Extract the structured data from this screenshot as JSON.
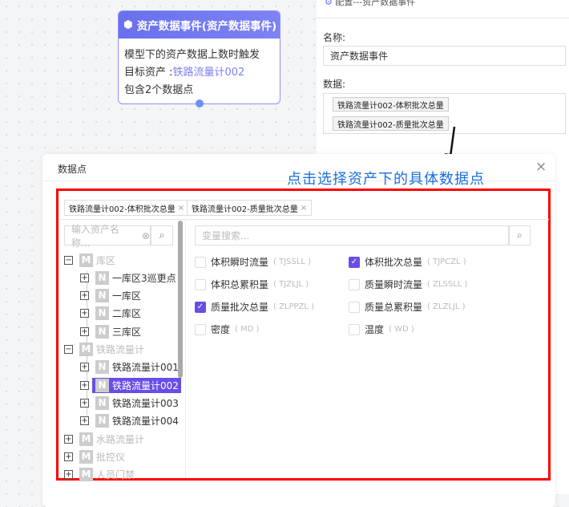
{
  "node": {
    "title": "资产数据事件(资产数据事件)",
    "desc": "模型下的资产数据上数时触发",
    "target_label": "目标资产 :",
    "target_value": "铁路流量计002",
    "count": "包含2个数据点"
  },
  "panel": {
    "header": "配置---资产数据事件",
    "name_label": "名称:",
    "name_value": "资产数据事件",
    "data_label": "数据:",
    "data_tags": [
      "铁路流量计002-体积批次总量",
      "铁路流量计002-质量批次总量"
    ]
  },
  "annotation": "点击选择资产下的具体数据点",
  "dialog": {
    "title": "数据点",
    "close": "×",
    "selected_tags": [
      "铁路流量计002-体积批次总量",
      "铁路流量计002-质量批次总量"
    ],
    "asset_search_placeholder": "输入资产名称...",
    "var_search_placeholder": "变量搜索...",
    "tree": [
      {
        "level": 0,
        "toggle": "−",
        "badge": "M",
        "label": "库区",
        "muted": true
      },
      {
        "level": 1,
        "toggle": "+",
        "badge": "N",
        "label": "一库区3巡更点"
      },
      {
        "level": 1,
        "toggle": "+",
        "badge": "N",
        "label": "一库区"
      },
      {
        "level": 1,
        "toggle": "+",
        "badge": "N",
        "label": "二库区"
      },
      {
        "level": 1,
        "toggle": "+",
        "badge": "N",
        "label": "三库区"
      },
      {
        "level": 0,
        "toggle": "−",
        "badge": "M",
        "label": "铁路流量计",
        "muted": true
      },
      {
        "level": 1,
        "toggle": "+",
        "badge": "N",
        "label": "铁路流量计001"
      },
      {
        "level": 1,
        "toggle": "+",
        "badge": "N",
        "label": "铁路流量计002",
        "selected": true
      },
      {
        "level": 1,
        "toggle": "+",
        "badge": "N",
        "label": "铁路流量计003"
      },
      {
        "level": 1,
        "toggle": "+",
        "badge": "N",
        "label": "铁路流量计004"
      },
      {
        "level": 0,
        "toggle": "+",
        "badge": "M",
        "label": "水路流量计",
        "muted": true
      },
      {
        "level": 0,
        "toggle": "+",
        "badge": "M",
        "label": "批控仪",
        "muted": true
      },
      {
        "level": 0,
        "toggle": "+",
        "badge": "M",
        "label": "人员门禁",
        "muted": true
      }
    ],
    "variables": [
      {
        "label": "体积瞬时流量",
        "code": "( TJSSLL )",
        "checked": false
      },
      {
        "label": "体积批次总量",
        "code": "( TJPCZL )",
        "checked": true
      },
      {
        "label": "体积总累积量",
        "code": "( TJZLJL )",
        "checked": false
      },
      {
        "label": "质量瞬时流量",
        "code": "( ZLSSLL )",
        "checked": false
      },
      {
        "label": "质量批次总量",
        "code": "( ZLPPZL )",
        "checked": true
      },
      {
        "label": "质量总累积量",
        "code": "( ZLZLJL )",
        "checked": false
      },
      {
        "label": "密度",
        "code": "( MD )",
        "checked": false
      },
      {
        "label": "温度",
        "code": "( WD )",
        "checked": false
      }
    ]
  },
  "colors": {
    "accent": "#6a4de6",
    "node_header": "#6d72f0",
    "annotation": "#1a6fe0",
    "highlight": "#ff0000"
  }
}
